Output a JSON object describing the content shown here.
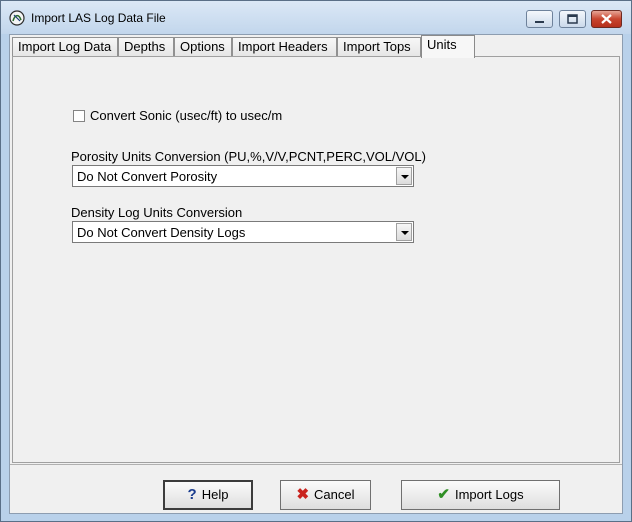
{
  "window": {
    "title": "Import LAS Log Data File",
    "icon": "app-logo-icon"
  },
  "tabs": [
    {
      "label": "Import Log Data"
    },
    {
      "label": "Depths"
    },
    {
      "label": "Options"
    },
    {
      "label": "Import Headers"
    },
    {
      "label": "Import Tops"
    },
    {
      "label": "Units"
    }
  ],
  "active_tab": "Units",
  "units": {
    "sonic_checkbox_label": "Convert Sonic (usec/ft) to usec/m",
    "sonic_checked": false,
    "porosity_label": "Porosity Units Conversion (PU,%,V/V,PCNT,PERC,VOL/VOL)",
    "porosity_value": "Do Not Convert Porosity",
    "density_label": "Density Log Units Conversion",
    "density_value": "Do Not Convert Density Logs"
  },
  "buttons": {
    "help": "Help",
    "cancel": "Cancel",
    "import": "Import Logs"
  },
  "colors": {
    "titlebar": "#c2d6ec",
    "close_button": "#c8452f",
    "client": "#f0f0f0"
  }
}
